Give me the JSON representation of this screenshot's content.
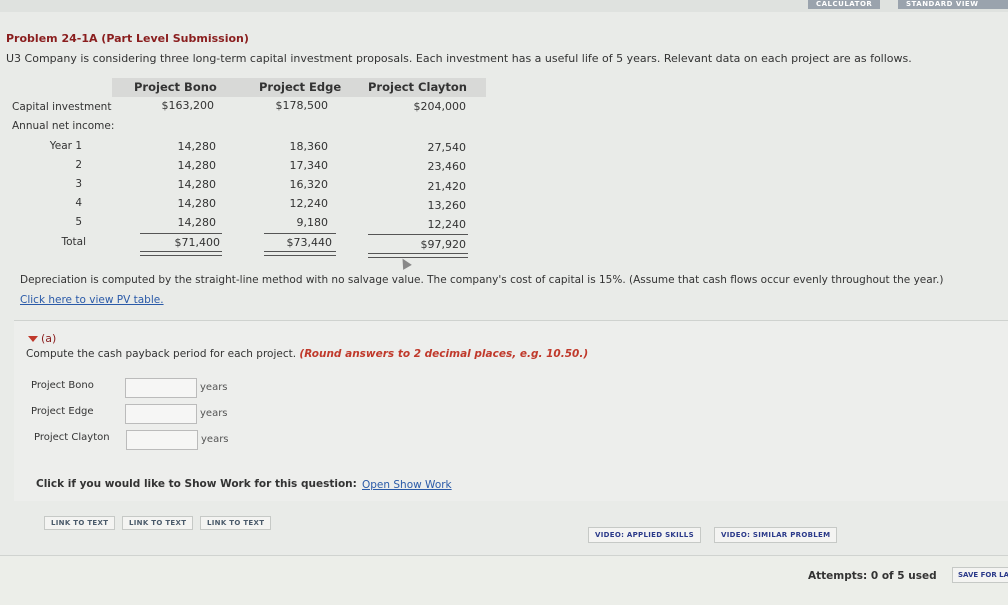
{
  "toolbar": {
    "calculator_label": "CALCULATOR",
    "standard_view_label": "STANDARD VIEW"
  },
  "problem": {
    "title": "Problem 24-1A (Part Level Submission)",
    "description": "U3 Company is considering three long-term capital investment proposals. Each investment has a useful life of 5 years. Relevant data on each project are as follows."
  },
  "table": {
    "headers": [
      "Project Bono",
      "Project Edge",
      "Project Clayton"
    ],
    "capital_label": "Capital investment",
    "capital": [
      "$163,200",
      "$178,500",
      "$204,000"
    ],
    "annual_label": "Annual net income:",
    "year_labels": [
      "Year  1",
      "2",
      "3",
      "4",
      "5"
    ],
    "bono": [
      "14,280",
      "14,280",
      "14,280",
      "14,280",
      "14,280"
    ],
    "edge": [
      "18,360",
      "17,340",
      "16,320",
      "12,240",
      "9,180"
    ],
    "clayton": [
      "27,540",
      "23,460",
      "21,420",
      "13,260",
      "12,240"
    ],
    "total_label": "Total",
    "totals": [
      "$71,400",
      "$73,440",
      "$97,920"
    ]
  },
  "notes": {
    "depreciation": "Depreciation is computed by the straight-line method with no salvage value. The company's cost of capital is 15%. (Assume that cash flows occur evenly throughout the year.)",
    "pv_link": "Click here to view PV table."
  },
  "part_a": {
    "label": "(a)",
    "question": "Compute the cash payback period for each project.",
    "hint": "(Round answers to 2 decimal places, e.g. 10.50.)",
    "rows": [
      {
        "label": "Project Bono",
        "value": "",
        "unit": "years"
      },
      {
        "label": "Project Edge",
        "value": "",
        "unit": "years"
      },
      {
        "label": "Project Clayton",
        "value": "",
        "unit": "years"
      }
    ]
  },
  "show_work": {
    "prompt": "Click if you would like to Show Work for this question:",
    "link": "Open Show Work"
  },
  "links": [
    "LINK TO TEXT",
    "LINK TO TEXT",
    "LINK TO TEXT"
  ],
  "videos": [
    "VIDEO: APPLIED SKILLS",
    "VIDEO: SIMILAR PROBLEM"
  ],
  "footer": {
    "attempts": "Attempts: 0 of 5 used",
    "save_label": "SAVE FOR LATER"
  }
}
